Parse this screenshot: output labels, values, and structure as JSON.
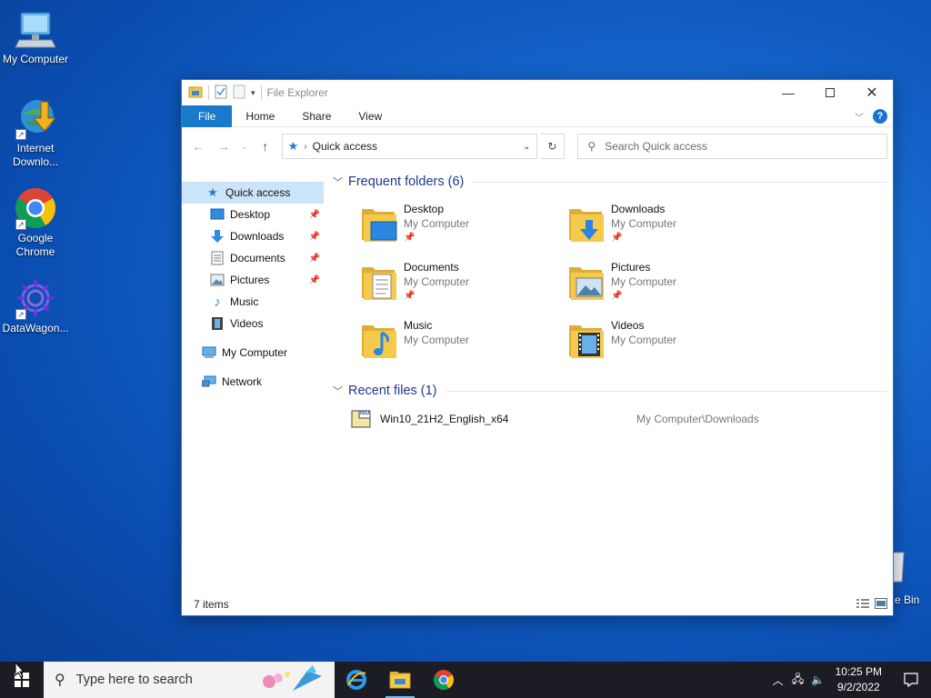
{
  "desktop": {
    "icons": [
      {
        "label": "My Computer"
      },
      {
        "label": "Internet Downlo..."
      },
      {
        "label": "Google Chrome"
      },
      {
        "label": "DataWagon..."
      }
    ],
    "recycle_bin_label": "e Bin"
  },
  "window": {
    "title": "File Explorer",
    "ribbon_tabs": [
      "File",
      "Home",
      "Share",
      "View"
    ],
    "help_glyph": "?",
    "address": "Quick access",
    "search_placeholder": "Search Quick access",
    "nav": [
      {
        "label": "Quick access",
        "icon": "star-icon"
      },
      {
        "label": "Desktop",
        "icon": "desktop-folder-icon",
        "pinned": true
      },
      {
        "label": "Downloads",
        "icon": "download-arrow-icon",
        "pinned": true
      },
      {
        "label": "Documents",
        "icon": "documents-icon",
        "pinned": true
      },
      {
        "label": "Pictures",
        "icon": "pictures-icon",
        "pinned": true
      },
      {
        "label": "Music",
        "icon": "music-note-icon"
      },
      {
        "label": "Videos",
        "icon": "film-icon"
      },
      {
        "label": "My Computer",
        "icon": "computer-icon"
      },
      {
        "label": "Network",
        "icon": "network-icon"
      }
    ],
    "frequent_header": "Frequent folders (6)",
    "frequent": [
      {
        "name": "Desktop",
        "location": "My Computer",
        "pinned": true
      },
      {
        "name": "Downloads",
        "location": "My Computer",
        "pinned": true
      },
      {
        "name": "Documents",
        "location": "My Computer",
        "pinned": true
      },
      {
        "name": "Pictures",
        "location": "My Computer",
        "pinned": true
      },
      {
        "name": "Music",
        "location": "My Computer",
        "pinned": false
      },
      {
        "name": "Videos",
        "location": "My Computer",
        "pinned": false
      }
    ],
    "recent_header": "Recent files (1)",
    "recent": [
      {
        "name": "Win10_21H2_English_x64",
        "path": "My Computer\\Downloads",
        "badge": "ISO"
      }
    ],
    "status": "7 items"
  },
  "taskbar": {
    "search_placeholder": "Type here to search",
    "time": "10:25 PM",
    "date": "9/2/2022"
  },
  "colors": {
    "accent": "#1979ca",
    "selected": "#cce4f7",
    "folder": "#f5c94c",
    "taskbar": "#1c1c24"
  }
}
